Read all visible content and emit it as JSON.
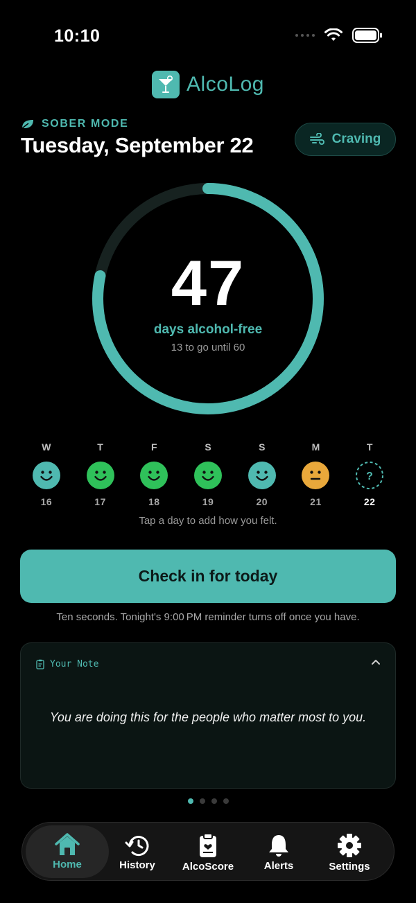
{
  "status_bar": {
    "time": "10:10"
  },
  "app": {
    "logo_text": "AlcoLog",
    "brand_color": "#4fb9b0"
  },
  "header": {
    "mode_label": "SOBER MODE",
    "date": "Tuesday, September 22",
    "craving_label": "Craving"
  },
  "progress": {
    "days": "47",
    "days_label": "days alcohol-free",
    "goal_label": "13 to go until 60",
    "goal_days": 60,
    "fraction": 0.783
  },
  "week": {
    "days": [
      {
        "letter": "W",
        "num": "16",
        "mood": "calm",
        "color": "#4fb9b0"
      },
      {
        "letter": "T",
        "num": "17",
        "mood": "happy",
        "color": "#2fc15a"
      },
      {
        "letter": "F",
        "num": "18",
        "mood": "happy",
        "color": "#2fc15a"
      },
      {
        "letter": "S",
        "num": "19",
        "mood": "happy",
        "color": "#2fc15a"
      },
      {
        "letter": "S",
        "num": "20",
        "mood": "calm",
        "color": "#4fb9b0"
      },
      {
        "letter": "M",
        "num": "21",
        "mood": "neutral",
        "color": "#e9a83b"
      },
      {
        "letter": "T",
        "num": "22",
        "mood": "unknown",
        "color": "#4fb9b0",
        "today": true
      }
    ],
    "hint": "Tap a day to add how you felt."
  },
  "checkin": {
    "label": "Check in for today",
    "reminder": "Ten seconds. Tonight's 9:00 PM reminder turns off once you have."
  },
  "note": {
    "title": "Your Note",
    "body": "You are doing this for the people who matter most to you."
  },
  "pager": {
    "count": 4,
    "active": 0
  },
  "tabs": [
    {
      "label": "Home",
      "icon": "home-icon",
      "active": true
    },
    {
      "label": "History",
      "icon": "history-icon"
    },
    {
      "label": "AlcoScore",
      "icon": "clipboard-heart-icon"
    },
    {
      "label": "Alerts",
      "icon": "bell-icon"
    },
    {
      "label": "Settings",
      "icon": "gear-icon"
    }
  ]
}
